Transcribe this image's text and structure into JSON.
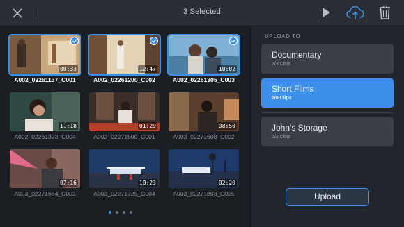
{
  "header": {
    "title": "3 Selected",
    "icons": [
      "close-icon",
      "play-icon",
      "cloud-upload-icon",
      "trash-icon"
    ]
  },
  "clips": [
    {
      "name": "A002_02261137_C001",
      "duration": "00:33",
      "selected": true
    },
    {
      "name": "A002_02261200_C002",
      "duration": "12:47",
      "selected": true
    },
    {
      "name": "A002_02261305_C003",
      "duration": "10:02",
      "selected": true
    },
    {
      "name": "A002_02261323_C004",
      "duration": "11:18",
      "selected": false
    },
    {
      "name": "A003_02271500_C001",
      "duration": "01:29",
      "selected": false
    },
    {
      "name": "A003_02271608_C002",
      "duration": "08:50",
      "selected": false
    },
    {
      "name": "A003_02271664_C003",
      "duration": "07:16",
      "selected": false
    },
    {
      "name": "A003_02271725_C004",
      "duration": "10:23",
      "selected": false
    },
    {
      "name": "A003_02271803_C005",
      "duration": "02:20",
      "selected": false
    }
  ],
  "pager": {
    "pages": 4,
    "current": 1
  },
  "upload_panel": {
    "heading": "UPLOAD TO",
    "destinations": [
      {
        "name": "Documentary",
        "count": "3/3 Clips",
        "active": false
      },
      {
        "name": "Short Films",
        "count": "0/0 Clips",
        "active": true
      },
      {
        "name": "John's Storage",
        "count": "2/2 Clips",
        "active": false
      }
    ],
    "upload_label": "Upload"
  },
  "colors": {
    "accent": "#3d90ea",
    "background": "#1b1e23",
    "topbar": "#2a2e35",
    "panel": "#22262c"
  }
}
